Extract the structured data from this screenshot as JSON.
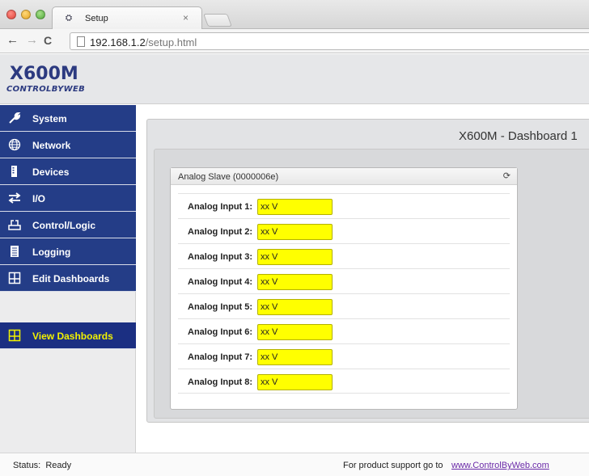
{
  "browser": {
    "tab_favicon": "ₔ",
    "tab_title": "Setup",
    "tab_close": "×",
    "url_host": "192.168.1.2",
    "url_path": "/setup.html"
  },
  "header": {
    "logo_main": "X600M",
    "logo_sub": "CONTROLBYWEB"
  },
  "sidebar": {
    "items": [
      {
        "label": "System",
        "icon": "wrench-icon"
      },
      {
        "label": "Network",
        "icon": "globe-icon"
      },
      {
        "label": "Devices",
        "icon": "device-icon"
      },
      {
        "label": "I/O",
        "icon": "arrows-icon"
      },
      {
        "label": "Control/Logic",
        "icon": "logic-icon"
      },
      {
        "label": "Logging",
        "icon": "log-icon"
      },
      {
        "label": "Edit Dashboards",
        "icon": "dashboard-icon"
      }
    ],
    "view_dashboards": {
      "label": "View Dashboards",
      "icon": "dashboard-icon",
      "color": "#f1f100"
    }
  },
  "dashboard": {
    "title": "X600M - Dashboard 1",
    "panel_title": "Analog Slave (0000006e)",
    "rows": [
      {
        "label": "Analog Input 1:",
        "value": "xx V"
      },
      {
        "label": "Analog Input 2:",
        "value": "xx V"
      },
      {
        "label": "Analog Input 3:",
        "value": "xx V"
      },
      {
        "label": "Analog Input 4:",
        "value": "xx V"
      },
      {
        "label": "Analog Input 5:",
        "value": "xx V"
      },
      {
        "label": "Analog Input 6:",
        "value": "xx V"
      },
      {
        "label": "Analog Input 7:",
        "value": "xx V"
      },
      {
        "label": "Analog Input 8:",
        "value": "xx V"
      }
    ]
  },
  "statusbar": {
    "status": "Status:  Ready",
    "support": "For product support go to",
    "link": "www.ControlByWeb.com"
  },
  "colors": {
    "nav_bg": "#243d87",
    "value_bg": "#ffff00",
    "link": "#6a2aa8"
  }
}
